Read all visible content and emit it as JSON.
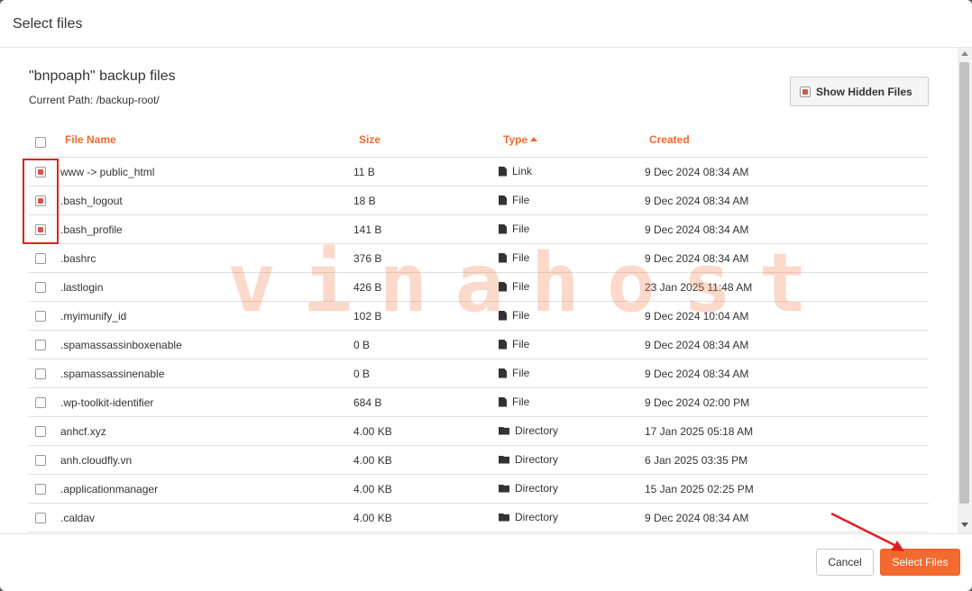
{
  "dialog": {
    "title": "Select files"
  },
  "content": {
    "title": "\"bnpoaph\" backup files",
    "path_label": "Current Path:",
    "path_value": "/backup-root/"
  },
  "show_hidden_label": "Show Hidden Files",
  "columns": {
    "name": "File Name",
    "size": "Size",
    "type": "Type",
    "created": "Created"
  },
  "rows": [
    {
      "name": "www -> public_html",
      "size": "11 B",
      "type": "Link",
      "icon": "file-icon",
      "created": "9 Dec 2024 08:34 AM",
      "checked": true
    },
    {
      "name": ".bash_logout",
      "size": "18 B",
      "type": "File",
      "icon": "file-icon",
      "created": "9 Dec 2024 08:34 AM",
      "checked": true
    },
    {
      "name": ".bash_profile",
      "size": "141 B",
      "type": "File",
      "icon": "file-icon",
      "created": "9 Dec 2024 08:34 AM",
      "checked": true
    },
    {
      "name": ".bashrc",
      "size": "376 B",
      "type": "File",
      "icon": "file-icon",
      "created": "9 Dec 2024 08:34 AM",
      "checked": false
    },
    {
      "name": ".lastlogin",
      "size": "426 B",
      "type": "File",
      "icon": "file-icon",
      "created": "23 Jan 2025 11:48 AM",
      "checked": false
    },
    {
      "name": ".myimunify_id",
      "size": "102 B",
      "type": "File",
      "icon": "file-icon",
      "created": "9 Dec 2024 10:04 AM",
      "checked": false
    },
    {
      "name": ".spamassassinboxenable",
      "size": "0 B",
      "type": "File",
      "icon": "file-icon",
      "created": "9 Dec 2024 08:34 AM",
      "checked": false
    },
    {
      "name": ".spamassassinenable",
      "size": "0 B",
      "type": "File",
      "icon": "file-icon",
      "created": "9 Dec 2024 08:34 AM",
      "checked": false
    },
    {
      "name": ".wp-toolkit-identifier",
      "size": "684 B",
      "type": "File",
      "icon": "file-icon",
      "created": "9 Dec 2024 02:00 PM",
      "checked": false
    },
    {
      "name": "anhcf.xyz",
      "size": "4.00 KB",
      "type": "Directory",
      "icon": "folder-icon",
      "created": "17 Jan 2025 05:18 AM",
      "checked": false
    },
    {
      "name": "anh.cloudfly.vn",
      "size": "4.00 KB",
      "type": "Directory",
      "icon": "folder-icon",
      "created": "6 Jan 2025 03:35 PM",
      "checked": false
    },
    {
      "name": ".applicationmanager",
      "size": "4.00 KB",
      "type": "Directory",
      "icon": "folder-icon",
      "created": "15 Jan 2025 02:25 PM",
      "checked": false
    },
    {
      "name": ".caldav",
      "size": "4.00 KB",
      "type": "Directory",
      "icon": "folder-icon",
      "created": "9 Dec 2024 08:34 AM",
      "checked": false
    }
  ],
  "watermark": "vinahost",
  "footer": {
    "cancel_label": "Cancel",
    "select_label": "Select Files"
  },
  "colors": {
    "accent": "#f26a2e",
    "checkbox_fill": "#d9534f",
    "highlight": "#e02020"
  }
}
